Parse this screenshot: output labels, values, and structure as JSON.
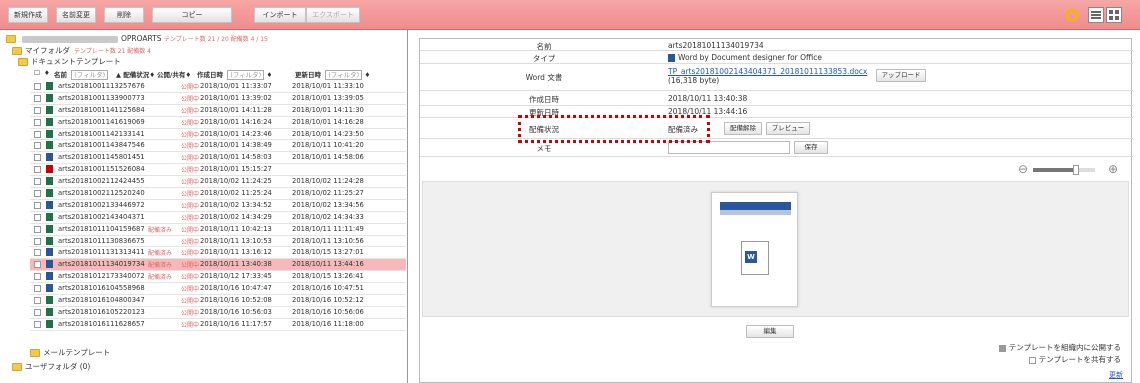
{
  "toolbar": {
    "buttons": [
      "新規作成",
      "名前変更",
      "削除",
      "コピー",
      "インポート",
      "エクスポート"
    ]
  },
  "left": {
    "crumb_label": "OPROARTS",
    "crumb_counts": "テンプレート数 21 / 20  配備数 4 / 15",
    "my_folder": "マイフォルダ",
    "my_folder_counts": "テンプレート数 21  配備数 4",
    "doc_templates": "ドキュメントテンプレート",
    "headers": {
      "name": "名前",
      "status": "配備状況",
      "share": "公開/共有",
      "created": "作成日時",
      "updated": "更新日時",
      "filter": "(フィルタ)"
    },
    "rows": [
      {
        "name": "arts20181001113257676",
        "type": "excel",
        "dep": "",
        "share": "公開中",
        "created": "2018/10/01 11:33:07",
        "updated": "2018/10/01 11:33:10"
      },
      {
        "name": "arts20181001133900773",
        "type": "excel",
        "dep": "",
        "share": "公開中",
        "created": "2018/10/01 13:39:02",
        "updated": "2018/10/01 13:39:05"
      },
      {
        "name": "arts20181001141125684",
        "type": "excel",
        "dep": "",
        "share": "公開中",
        "created": "2018/10/01 14:11:28",
        "updated": "2018/10/01 14:11:30"
      },
      {
        "name": "arts20181001141619069",
        "type": "excel",
        "dep": "",
        "share": "公開中",
        "created": "2018/10/01 14:16:24",
        "updated": "2018/10/01 14:16:28"
      },
      {
        "name": "arts20181001142133141",
        "type": "excel",
        "dep": "",
        "share": "公開中",
        "created": "2018/10/01 14:23:46",
        "updated": "2018/10/01 14:23:50"
      },
      {
        "name": "arts20181001143847546",
        "type": "excel",
        "dep": "",
        "share": "公開中",
        "created": "2018/10/01 14:38:49",
        "updated": "2018/10/11 10:41:20"
      },
      {
        "name": "arts20181001145801451",
        "type": "word",
        "dep": "",
        "share": "公開中",
        "created": "2018/10/01 14:58:03",
        "updated": "2018/10/01 14:58:06"
      },
      {
        "name": "arts20181001151526084",
        "type": "pdf",
        "dep": "",
        "share": "公開中",
        "created": "2018/10/01 15:15:27",
        "updated": ""
      },
      {
        "name": "arts20181002112424455",
        "type": "excel",
        "dep": "",
        "share": "公開中",
        "created": "2018/10/02 11:24:25",
        "updated": "2018/10/02 11:24:28"
      },
      {
        "name": "arts20181002112520240",
        "type": "excel",
        "dep": "",
        "share": "公開中",
        "created": "2018/10/02 11:25:24",
        "updated": "2018/10/02 11:25:27"
      },
      {
        "name": "arts20181002133446972",
        "type": "word",
        "dep": "",
        "share": "公開中",
        "created": "2018/10/02 13:34:52",
        "updated": "2018/10/02 13:34:56"
      },
      {
        "name": "arts20181002143404371",
        "type": "excel",
        "dep": "",
        "share": "公開中",
        "created": "2018/10/02 14:34:29",
        "updated": "2018/10/02 14:34:33"
      },
      {
        "name": "arts20181011104159687",
        "type": "excel",
        "dep": "配備済み",
        "share": "公開中",
        "created": "2018/10/11 10:42:13",
        "updated": "2018/10/11 11:11:49"
      },
      {
        "name": "arts20181011130836675",
        "type": "excel",
        "dep": "",
        "share": "公開中",
        "created": "2018/10/11 13:10:53",
        "updated": "2018/10/11 13:10:56"
      },
      {
        "name": "arts20181011131313411",
        "type": "word",
        "dep": "配備済み",
        "share": "公開中",
        "created": "2018/10/11 13:16:12",
        "updated": "2018/10/15 13:27:01"
      },
      {
        "name": "arts20181011134019734",
        "type": "word",
        "dep": "配備済み",
        "share": "公開中",
        "created": "2018/10/11 13:40:38",
        "updated": "2018/10/11 13:44:16",
        "selected": true
      },
      {
        "name": "arts20181012173340072",
        "type": "word",
        "dep": "配備済み",
        "share": "公開中",
        "created": "2018/10/12 17:33:45",
        "updated": "2018/10/15 13:26:41"
      },
      {
        "name": "arts20181016104558968",
        "type": "word",
        "dep": "",
        "share": "公開中",
        "created": "2018/10/16 10:47:47",
        "updated": "2018/10/16 10:47:51"
      },
      {
        "name": "arts20181016104800347",
        "type": "excel",
        "dep": "",
        "share": "公開中",
        "created": "2018/10/16 10:52:08",
        "updated": "2018/10/16 10:52:12"
      },
      {
        "name": "arts20181016105220123",
        "type": "excel",
        "dep": "",
        "share": "公開中",
        "created": "2018/10/16 10:56:03",
        "updated": "2018/10/16 10:56:06"
      },
      {
        "name": "arts20181016111628657",
        "type": "excel",
        "dep": "",
        "share": "公開中",
        "created": "2018/10/16 11:17:57",
        "updated": "2018/10/16 11:18:00"
      }
    ],
    "mail_templates": "メールテンプレート",
    "user_folder": "ユーザフォルダ (0)"
  },
  "right": {
    "props": {
      "name_k": "名前",
      "name_v": "arts20181011134019734",
      "type_k": "タイプ",
      "type_v": "Word by Document designer for Office",
      "file_k": "Word 文書",
      "file_v": "TP_arts20181002143404371_20181011133853.docx",
      "file_size": "(16,318 byte)",
      "upload_btn": "アップロード",
      "created_k": "作成日時",
      "created_v": "2018/10/11 13:40:38",
      "updated_k": "更新日時",
      "updated_v": "2018/10/11 13:44:16",
      "status_k": "配備状況",
      "status_v": "配備済み",
      "undeploy_btn": "配備解除",
      "preview_btn": "プレビュー",
      "memo_k": "メモ",
      "save_btn": "保存"
    },
    "zoom_level": 0.7,
    "edit_btn": "編集",
    "publish_label": "テンプレートを組織内に公開する",
    "share_label": "テンプレートを共有する",
    "update_link": "更新",
    "colors": {
      "toolbar": "#f7a6a6",
      "selected_row": "#f6b8b8",
      "highlight": "#d00000"
    }
  }
}
